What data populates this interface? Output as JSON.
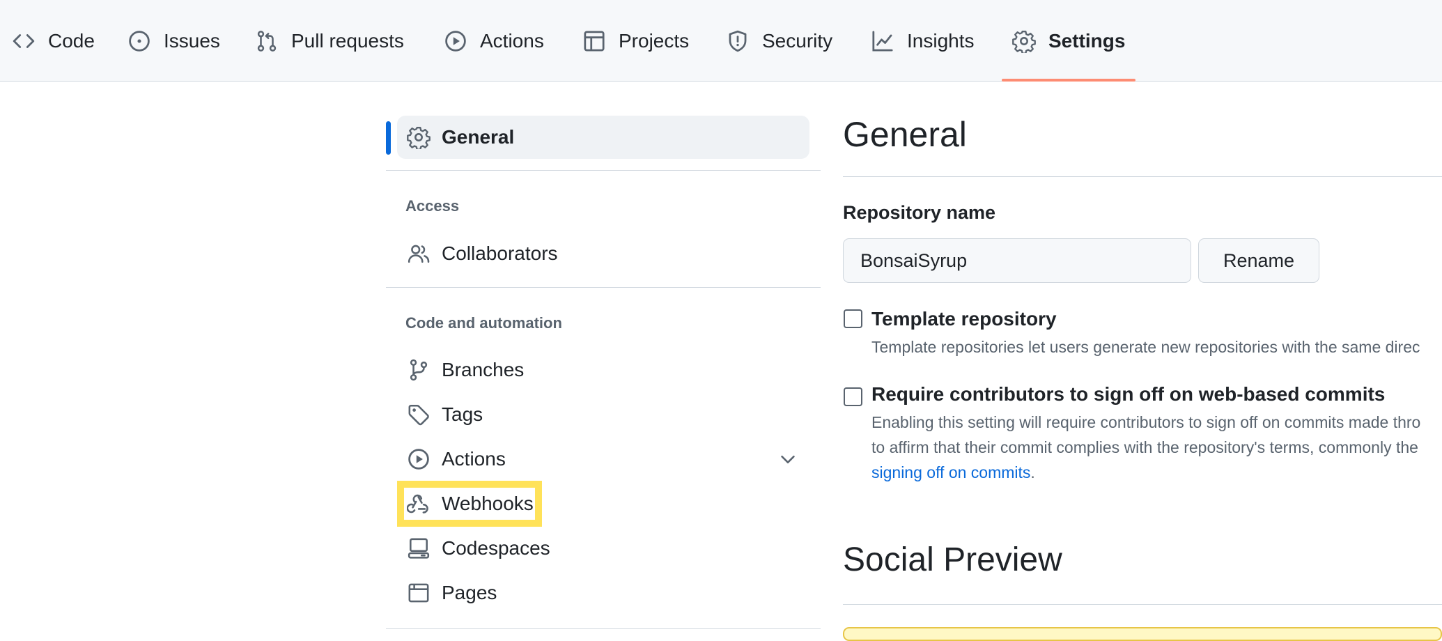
{
  "repo_nav": {
    "tabs": [
      {
        "label": "Code",
        "icon": "code-icon"
      },
      {
        "label": "Issues",
        "icon": "issue-icon"
      },
      {
        "label": "Pull requests",
        "icon": "pull-request-icon"
      },
      {
        "label": "Actions",
        "icon": "play-icon"
      },
      {
        "label": "Projects",
        "icon": "table-icon"
      },
      {
        "label": "Security",
        "icon": "shield-icon"
      },
      {
        "label": "Insights",
        "icon": "graph-icon"
      },
      {
        "label": "Settings",
        "icon": "gear-icon",
        "active": true
      }
    ],
    "active_underline_color": "#fd8c73"
  },
  "sidebar": {
    "general": {
      "label": "General",
      "icon": "gear-icon",
      "selected": true
    },
    "access_heading": "Access",
    "access_items": [
      {
        "label": "Collaborators",
        "icon": "people-icon"
      }
    ],
    "code_heading": "Code and automation",
    "code_items": [
      {
        "label": "Branches",
        "icon": "branch-icon"
      },
      {
        "label": "Tags",
        "icon": "tag-icon"
      },
      {
        "label": "Actions",
        "icon": "play-icon",
        "expandable": true
      },
      {
        "label": "Webhooks",
        "icon": "webhook-icon",
        "highlighted": true
      },
      {
        "label": "Codespaces",
        "icon": "codespaces-icon"
      },
      {
        "label": "Pages",
        "icon": "browser-icon"
      }
    ],
    "active_bar_color": "#0969da",
    "highlight_color": "#ffe259"
  },
  "main": {
    "title": "General",
    "repo_name": {
      "label": "Repository name",
      "value": "BonsaiSyrup",
      "rename_button": "Rename"
    },
    "template": {
      "title": "Template repository",
      "description": "Template repositories let users generate new repositories with the same direc",
      "checked": false
    },
    "signoff": {
      "title": "Require contributors to sign off on web-based commits",
      "description_line1": "Enabling this setting will require contributors to sign off on commits made thro",
      "description_line2": "to affirm that their commit complies with the repository's terms, commonly the",
      "link_text": "signing off on commits",
      "link_suffix": ".",
      "checked": false
    },
    "social_preview_title": "Social Preview"
  }
}
